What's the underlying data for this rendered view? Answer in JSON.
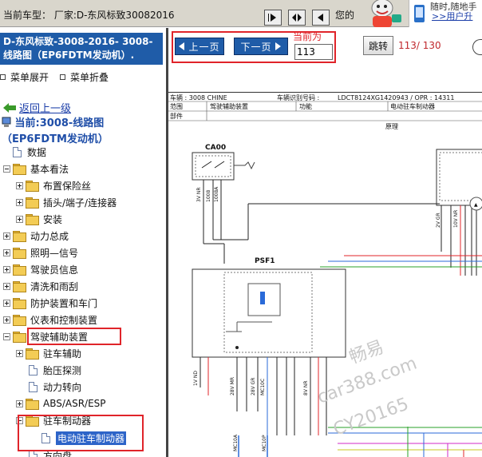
{
  "topbar": {
    "model_text": "当前车型：  厂家:D-东风标致30082016",
    "partial_text": "您的",
    "promo_line1": "随时,随地手",
    "promo_link": ">>用户升"
  },
  "left": {
    "header_title": "D-东风标致-3008-2016- 3008-线路图（EP6FDTM发动机）.",
    "expand_all": "菜单展开",
    "collapse_all": "菜单折叠",
    "back_link": "返回上一级",
    "current_path": "当前:3008-线路图（EP6FDTM发动机）",
    "tree": [
      {
        "label": "数据",
        "type": "doc",
        "level": 0,
        "state": "leaf"
      },
      {
        "label": "基本看法",
        "type": "folder",
        "level": 0,
        "state": "open"
      },
      {
        "label": "布置保险丝",
        "type": "folder",
        "level": 1,
        "state": "closed"
      },
      {
        "label": "插头/端子/连接器",
        "type": "folder",
        "level": 1,
        "state": "closed"
      },
      {
        "label": "安装",
        "type": "folder",
        "level": 1,
        "state": "closed"
      },
      {
        "label": "动力总成",
        "type": "folder",
        "level": 0,
        "state": "closed"
      },
      {
        "label": "照明—信号",
        "type": "folder",
        "level": 0,
        "state": "closed"
      },
      {
        "label": "驾驶员信息",
        "type": "folder",
        "level": 0,
        "state": "closed"
      },
      {
        "label": " 清洗和雨刮",
        "type": "folder",
        "level": 0,
        "state": "closed"
      },
      {
        "label": "防护装置和车门",
        "type": "folder",
        "level": 0,
        "state": "closed"
      },
      {
        "label": "仪表和控制装置",
        "type": "folder",
        "level": 0,
        "state": "closed"
      },
      {
        "label": "驾驶辅助装置",
        "type": "folder",
        "level": 0,
        "state": "open"
      },
      {
        "label": "驻车辅助",
        "type": "folder",
        "level": 1,
        "state": "closed"
      },
      {
        "label": "胎压探测",
        "type": "doc",
        "level": 1,
        "state": "leaf"
      },
      {
        "label": "动力转向",
        "type": "doc",
        "level": 1,
        "state": "leaf"
      },
      {
        "label": "ABS/ASR/ESP",
        "type": "folder",
        "level": 1,
        "state": "closed"
      },
      {
        "label": "驻车制动器",
        "type": "folder",
        "level": 1,
        "state": "open"
      },
      {
        "label": "电动驻车制动器",
        "type": "doc",
        "level": 2,
        "state": "selected"
      },
      {
        "label": "方向盘",
        "type": "doc",
        "level": 1,
        "state": "leaf"
      }
    ]
  },
  "toolbar": {
    "prev_label": "上一页",
    "next_label": "下一页",
    "current_label": "当前为",
    "current_value": "113",
    "jump_label": "跳转",
    "page_info": "113/ 130"
  },
  "diagram": {
    "vehicle_line": "车辆 : 3008 CHINE",
    "vin_label": "车辆识别号码 :",
    "vin_value": "LDCT8124XG1420943 / OPR : 14311",
    "scope_label": "范围",
    "scope_value": "驾驶辅助装置",
    "function_label": "功能",
    "function_value": "电动驻车制动器",
    "part_label": "部件",
    "principle_label": "原理",
    "components": [
      "CA00",
      "PSF1"
    ],
    "watermark": [
      "畅易",
      "car388.com",
      "CY20165"
    ]
  },
  "colors": {
    "header_blue": "#1f5ca8",
    "highlight_red": "#e0242a",
    "link_blue": "#1a3da8",
    "topbar_bg": "#d9d6cc"
  }
}
